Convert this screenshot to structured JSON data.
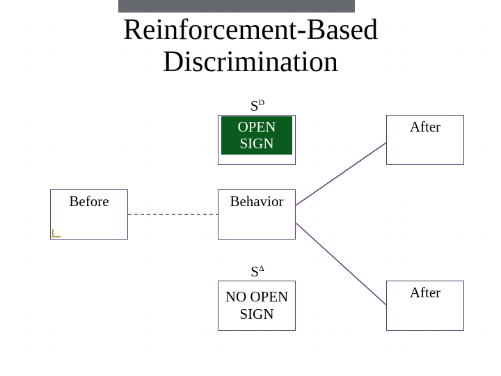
{
  "title_line1": "Reinforcement-Based",
  "title_line2": "Discrimination",
  "sd": {
    "symbol": "S",
    "super": "D",
    "text": "OPEN SIGN"
  },
  "sdelta": {
    "symbol": "S",
    "super": "Δ",
    "text": "NO OPEN SIGN"
  },
  "before": {
    "label": "Before"
  },
  "behavior": {
    "label": "Behavior"
  },
  "after_top": {
    "label": "After"
  },
  "after_bottom": {
    "label": "After"
  },
  "colors": {
    "border": "#5a3a6a",
    "accent_green": "#0b5a1e",
    "corner_gold": "#b6a14a"
  }
}
